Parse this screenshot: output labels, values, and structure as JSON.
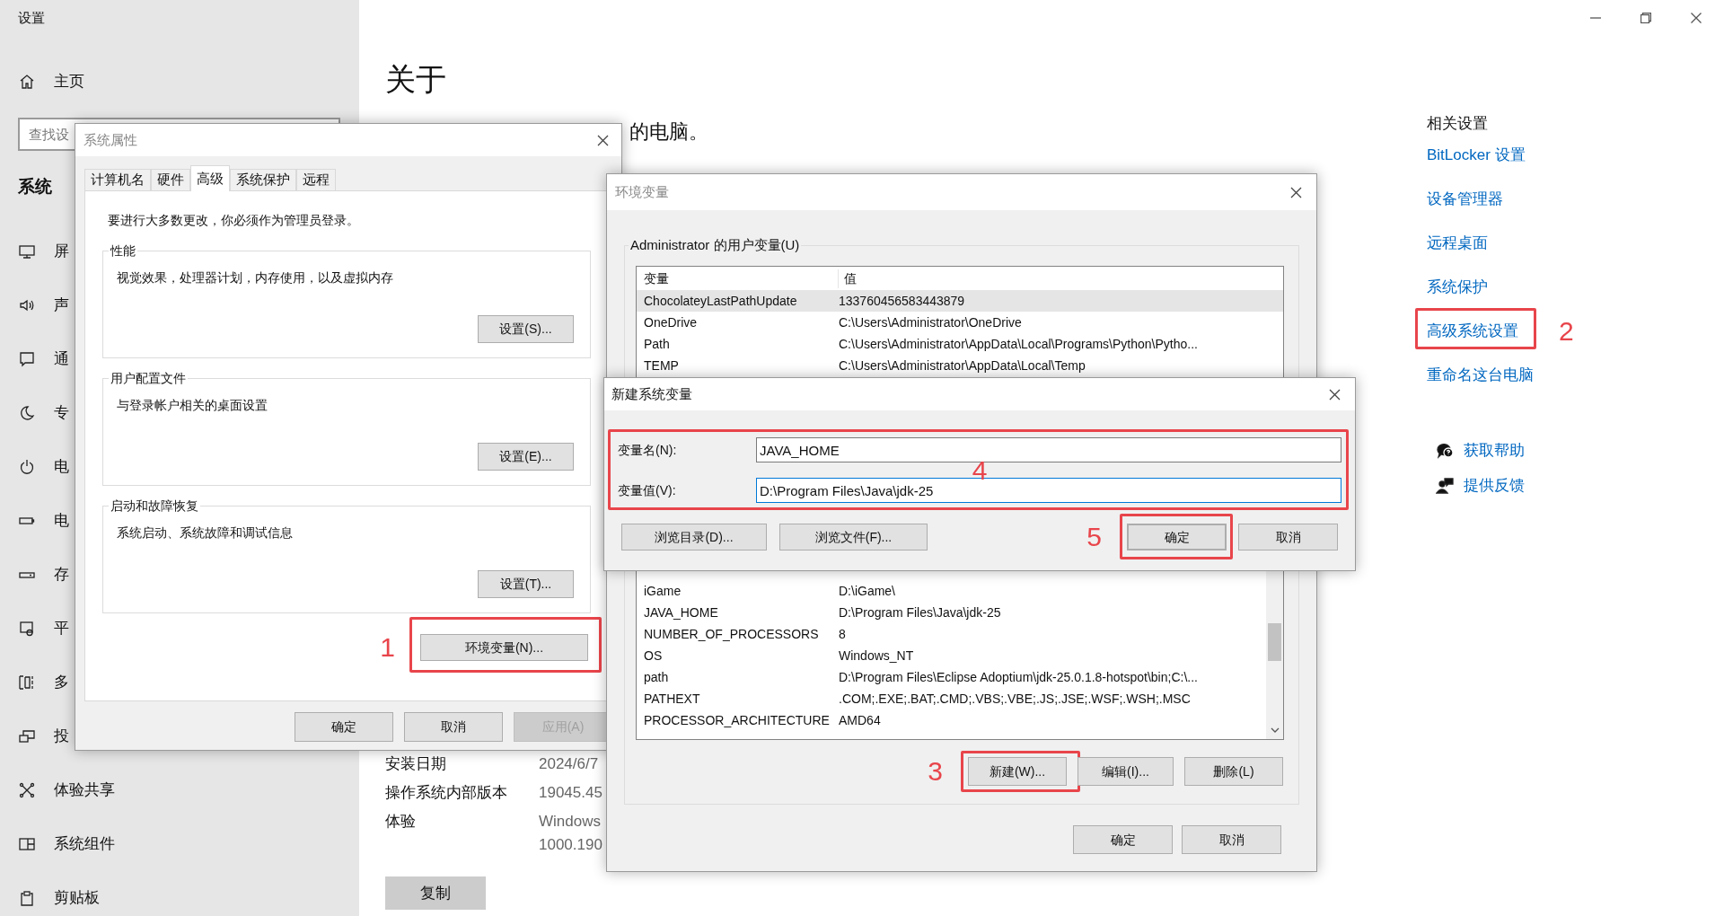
{
  "settings": {
    "title": "设置",
    "home": {
      "kind": "home",
      "label": "主页"
    },
    "search": {
      "placeholder": "查找设"
    },
    "section": "系统",
    "nav": [
      {
        "kind": "display",
        "label": "屏"
      },
      {
        "kind": "sound",
        "label": "声"
      },
      {
        "kind": "notification",
        "label": "通"
      },
      {
        "kind": "focus",
        "label": "专"
      },
      {
        "kind": "power",
        "label": "电"
      },
      {
        "kind": "battery",
        "label": "电"
      },
      {
        "kind": "storage",
        "label": "存"
      },
      {
        "kind": "tablet",
        "label": "平"
      },
      {
        "kind": "multitask",
        "label": "多"
      },
      {
        "kind": "project",
        "label": "投"
      },
      {
        "kind": "share",
        "label": "体验共享"
      },
      {
        "kind": "components",
        "label": "系统组件"
      },
      {
        "kind": "clipboard",
        "label": "剪贴板"
      }
    ],
    "page_title": "关于",
    "subtitle": "的电脑。",
    "specs": [
      {
        "label": "安装日期",
        "value": [
          "2024/6/7"
        ]
      },
      {
        "label": "操作系统内部版本",
        "value": [
          "19045.45"
        ]
      },
      {
        "label": "体验",
        "value": [
          "Windows",
          "1000.190"
        ]
      }
    ],
    "copy_button": "复制",
    "related": {
      "heading": "相关设置",
      "links": [
        {
          "label": "BitLocker 设置"
        },
        {
          "label": "设备管理器"
        },
        {
          "label": "远程桌面"
        },
        {
          "label": "系统保护"
        },
        {
          "label": "高级系统设置",
          "annotation": {
            "number": "2"
          }
        },
        {
          "label": "重命名这台电脑"
        }
      ]
    },
    "support": [
      {
        "kind": "help",
        "label": "获取帮助"
      },
      {
        "kind": "feedback",
        "label": "提供反馈"
      }
    ]
  },
  "system_properties": {
    "title": "系统属性",
    "tabs": [
      {
        "label": "计算机名",
        "selected": false
      },
      {
        "label": "硬件",
        "selected": false
      },
      {
        "label": "高级",
        "selected": true
      },
      {
        "label": "系统保护",
        "selected": false
      },
      {
        "label": "远程",
        "selected": false
      }
    ],
    "notice": "要进行大多数更改，你必须作为管理员登录。",
    "groups": [
      {
        "title": "性能",
        "description": "视觉效果，处理器计划，内存使用，以及虚拟内存",
        "button": "设置(S)..."
      },
      {
        "title": "用户配置文件",
        "description": "与登录帐户相关的桌面设置",
        "button": "设置(E)..."
      },
      {
        "title": "启动和故障恢复",
        "description": "系统启动、系统故障和调试信息",
        "button": "设置(T)..."
      }
    ],
    "env_button": {
      "label": "环境变量(N)...",
      "annotation": {
        "number": "1"
      }
    },
    "buttons": [
      {
        "label": "确定",
        "disabled": false
      },
      {
        "label": "取消",
        "disabled": false
      },
      {
        "label": "应用(A)",
        "disabled": true
      }
    ]
  },
  "environment_variables": {
    "title": "环境变量",
    "user_group": "Administrator 的用户变量(U)",
    "user_columns": [
      "变量",
      "值"
    ],
    "user_rows": [
      {
        "name": "ChocolateyLastPathUpdate",
        "value": "133760456583443879",
        "selected": true
      },
      {
        "name": "OneDrive",
        "value": "C:\\Users\\Administrator\\OneDrive",
        "selected": false
      },
      {
        "name": "Path",
        "value": "C:\\Users\\Administrator\\AppData\\Local\\Programs\\Python\\Pytho...",
        "selected": false
      },
      {
        "name": "TEMP",
        "value": "C:\\Users\\Administrator\\AppData\\Local\\Temp",
        "selected": false
      }
    ],
    "system_rows": [
      {
        "name": "iGame",
        "value": "D:\\iGame\\",
        "selected": false
      },
      {
        "name": "JAVA_HOME",
        "value": "D:\\Program Files\\Java\\jdk-25",
        "selected": false
      },
      {
        "name": "NUMBER_OF_PROCESSORS",
        "value": "8",
        "selected": false
      },
      {
        "name": "OS",
        "value": "Windows_NT",
        "selected": false
      },
      {
        "name": "path",
        "value": "D:\\Program Files\\Eclipse Adoptium\\jdk-25.0.1.8-hotspot\\bin;C:\\...",
        "selected": false
      },
      {
        "name": "PATHEXT",
        "value": ".COM;.EXE;.BAT;.CMD;.VBS;.VBE;.JS;.JSE;.WSF;.WSH;.MSC",
        "selected": false
      },
      {
        "name": "PROCESSOR_ARCHITECTURE",
        "value": "AMD64",
        "selected": false
      }
    ],
    "system_buttons": [
      {
        "label": "新建(W)...",
        "annotation": {
          "number": "3"
        }
      },
      {
        "label": "编辑(I)..."
      },
      {
        "label": "删除(L)"
      }
    ],
    "buttons": [
      "确定",
      "取消"
    ]
  },
  "new_variable": {
    "title": "新建系统变量",
    "fields": [
      {
        "label": "变量名(N):",
        "value": "JAVA_HOME",
        "focused": false
      },
      {
        "label": "变量值(V):",
        "value": "D:\\Program Files\\Java\\jdk-25",
        "focused": true
      }
    ],
    "fields_annotation": {
      "number": "4"
    },
    "browse_buttons": [
      "浏览目录(D)...",
      "浏览文件(F)..."
    ],
    "buttons": [
      {
        "label": "确定",
        "default": true,
        "annotation": {
          "number": "5"
        }
      },
      {
        "label": "取消",
        "default": false
      }
    ]
  }
}
